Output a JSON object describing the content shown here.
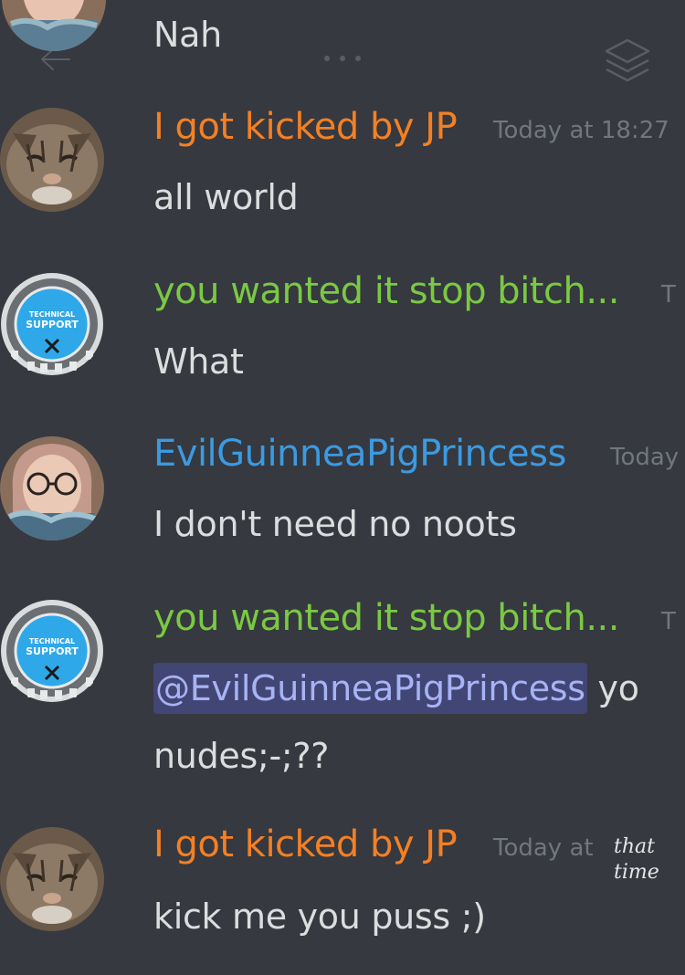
{
  "colors": {
    "background": "#36393f",
    "text": "#dcddde",
    "timestamp": "#72767d",
    "orange_user": "#f48024",
    "green_user": "#7ac943",
    "blue_user": "#3b9ae1",
    "mention_bg": "#414675",
    "mention_text": "#a8b3f5"
  },
  "messages": [
    {
      "username": "",
      "timestamp": "",
      "lines": [
        "Nah"
      ],
      "avatar": "guinea-pig-princess-avatar"
    },
    {
      "username": "I got kicked by JP",
      "timestamp": "Today at 18:27",
      "lines": [
        "all world"
      ],
      "avatar": "cat-avatar"
    },
    {
      "username": "you wanted it stop bitch...",
      "timestamp": "T",
      "lines": [
        "What"
      ],
      "avatar": "technical-support-avatar"
    },
    {
      "username": "EvilGuinneaPigPrincess",
      "timestamp": "Today",
      "lines": [
        "I don't need no noots"
      ],
      "avatar": "guinea-pig-princess-avatar"
    },
    {
      "username": "you wanted it stop bitch...",
      "timestamp": "T",
      "mention": "@EvilGuinneaPigPrincess",
      "mention_suffix": " yo",
      "lines": [
        "nudes;-;??"
      ],
      "avatar": "technical-support-avatar"
    },
    {
      "username": "I got kicked by JP",
      "timestamp": "Today at",
      "annotation": "that time",
      "lines": [
        "kick me you puss ;)"
      ],
      "avatar": "cat-avatar"
    }
  ],
  "badge_text": {
    "line1": "TECHNICAL",
    "line2": "SUPPORT"
  },
  "icons": {
    "back": "back-arrow-icon",
    "more": "more-dots-icon",
    "layers": "layers-icon"
  }
}
